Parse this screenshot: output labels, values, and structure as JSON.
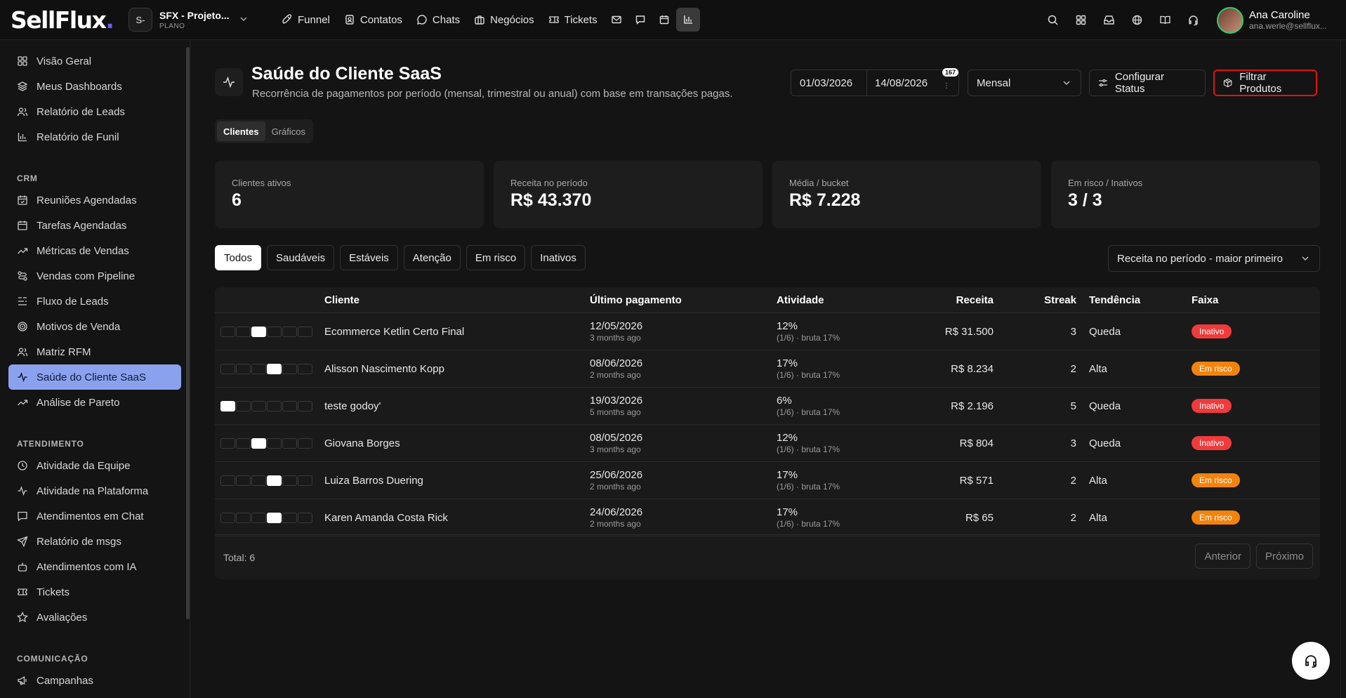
{
  "app": {
    "logo_text": "SellFlux",
    "logo_dot": ".",
    "project_badge": "S-",
    "project_name": "SFX - Projeto...",
    "project_plan": "PLANO"
  },
  "topnav": {
    "items": [
      {
        "label": "Funnel",
        "icon": "rocket-icon"
      },
      {
        "label": "Contatos",
        "icon": "contacts-icon"
      },
      {
        "label": "Chats",
        "icon": "chat-bubble-icon"
      },
      {
        "label": "Negócios",
        "icon": "briefcase-icon"
      },
      {
        "label": "Tickets",
        "icon": "ticket-icon"
      }
    ],
    "icon_buttons": [
      "mail-icon",
      "message-icon",
      "calendar-icon",
      "bar-chart-icon"
    ]
  },
  "user": {
    "name": "Ana Caroline",
    "email": "ana.werle@sellflux..."
  },
  "sidebar": {
    "top_items": [
      {
        "label": "Visão Geral",
        "icon": "grid-icon"
      },
      {
        "label": "Meus Dashboards",
        "icon": "layers-icon"
      },
      {
        "label": "Relatório de Leads",
        "icon": "users-icon"
      },
      {
        "label": "Relatório de Funil",
        "icon": "bar-chart-icon"
      }
    ],
    "crm_heading": "CRM",
    "crm_items": [
      {
        "label": "Reuniões Agendadas",
        "icon": "calendar-check-icon"
      },
      {
        "label": "Tarefas Agendadas",
        "icon": "calendar-icon"
      },
      {
        "label": "Métricas de Vendas",
        "icon": "trend-up-icon"
      },
      {
        "label": "Vendas com Pipeline",
        "icon": "pipeline-icon"
      },
      {
        "label": "Fluxo de Leads",
        "icon": "list-flow-icon"
      },
      {
        "label": "Motivos de Venda",
        "icon": "target-icon"
      },
      {
        "label": "Matriz RFM",
        "icon": "users-icon"
      },
      {
        "label": "Saúde do Cliente SaaS",
        "icon": "activity-icon",
        "active": true
      },
      {
        "label": "Análise de Pareto",
        "icon": "trend-up-icon"
      }
    ],
    "atend_heading": "ATENDIMENTO",
    "atend_items": [
      {
        "label": "Atividade da Equipe",
        "icon": "clock-icon"
      },
      {
        "label": "Atividade na Plataforma",
        "icon": "activity-icon"
      },
      {
        "label": "Atendimentos em Chat",
        "icon": "chat-square-icon"
      },
      {
        "label": "Relatório de msgs",
        "icon": "send-icon"
      },
      {
        "label": "Atendimentos com IA",
        "icon": "robot-icon"
      },
      {
        "label": "Tickets",
        "icon": "ticket-icon"
      },
      {
        "label": "Avaliações",
        "icon": "star-icon"
      }
    ],
    "com_heading": "COMUNICAÇÃO",
    "com_items": [
      {
        "label": "Campanhas",
        "icon": "megaphone-icon"
      }
    ]
  },
  "page": {
    "title": "Saúde do Cliente SaaS",
    "subtitle": "Recorrência de pagamentos por período (mensal, trimestral ou anual) com base em transações pagas.",
    "date_start": "01/03/2026",
    "date_end": "14/08/2026",
    "date_badge": "167",
    "period_select": "Mensal",
    "config_status_label": "Configurar Status",
    "filter_products_label": "Filtrar Produtos",
    "view_tabs": [
      "Clientes",
      "Gráficos"
    ]
  },
  "kpis": [
    {
      "label": "Clientes ativos",
      "value": "6"
    },
    {
      "label": "Receita no período",
      "value": "R$ 43.370"
    },
    {
      "label": "Média / bucket",
      "value": "R$ 7.228"
    },
    {
      "label": "Em risco / Inativos",
      "value": "3 / 3"
    }
  ],
  "filters": [
    "Todos",
    "Saudáveis",
    "Estáveis",
    "Atenção",
    "Em risco",
    "Inativos"
  ],
  "sort_select": "Receita no período - maior primeiro",
  "table": {
    "headers": [
      "Cliente",
      "Último pagamento",
      "Atividade",
      "Receita",
      "Streak",
      "Tendência",
      "Faixa"
    ],
    "rows": [
      {
        "active_cells": [
          2
        ],
        "client": "Ecommerce Ketlin Certo Final",
        "last_date": "12/05/2026",
        "last_ago": "3 months ago",
        "activity": "12%",
        "activity_sub": "(1/6) · bruta 17%",
        "revenue": "R$ 31.500",
        "streak": "3",
        "trend": "Queda",
        "band": "Inativo",
        "band_type": "inativo"
      },
      {
        "active_cells": [
          3
        ],
        "client": "Alisson Nascimento Kopp",
        "last_date": "08/06/2026",
        "last_ago": "2 months ago",
        "activity": "17%",
        "activity_sub": "(1/6) · bruta 17%",
        "revenue": "R$ 8.234",
        "streak": "2",
        "trend": "Alta",
        "band": "Em risco",
        "band_type": "risco"
      },
      {
        "active_cells": [
          0
        ],
        "client": "teste godoy'",
        "last_date": "19/03/2026",
        "last_ago": "5 months ago",
        "activity": "6%",
        "activity_sub": "(1/6) · bruta 17%",
        "revenue": "R$ 2.196",
        "streak": "5",
        "trend": "Queda",
        "band": "Inativo",
        "band_type": "inativo"
      },
      {
        "active_cells": [
          2
        ],
        "client": "Giovana Borges",
        "last_date": "08/05/2026",
        "last_ago": "3 months ago",
        "activity": "12%",
        "activity_sub": "(1/6) · bruta 17%",
        "revenue": "R$ 804",
        "streak": "3",
        "trend": "Queda",
        "band": "Inativo",
        "band_type": "inativo"
      },
      {
        "active_cells": [
          3
        ],
        "client": "Luiza Barros Duering",
        "last_date": "25/06/2026",
        "last_ago": "2 months ago",
        "activity": "17%",
        "activity_sub": "(1/6) · bruta 17%",
        "revenue": "R$ 571",
        "streak": "2",
        "trend": "Alta",
        "band": "Em risco",
        "band_type": "risco"
      },
      {
        "active_cells": [
          3
        ],
        "client": "Karen Amanda Costa Rick",
        "last_date": "24/06/2026",
        "last_ago": "2 months ago",
        "activity": "17%",
        "activity_sub": "(1/6) · bruta 17%",
        "revenue": "R$ 65",
        "streak": "2",
        "trend": "Alta",
        "band": "Em risco",
        "band_type": "risco"
      }
    ],
    "total": "Total: 6",
    "prev_label": "Anterior",
    "next_label": "Próximo"
  }
}
